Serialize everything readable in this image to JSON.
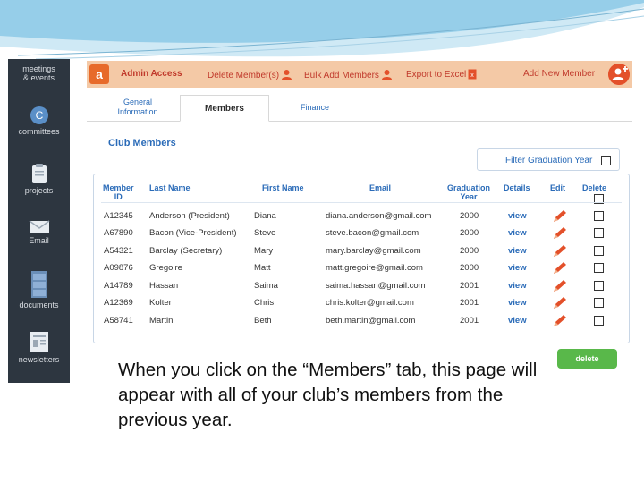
{
  "sidebar": {
    "items": [
      {
        "label": "meetings\n& events",
        "icon": "calendar-icon"
      },
      {
        "label": "committees",
        "icon": "committees-c-icon"
      },
      {
        "label": "projects",
        "icon": "clipboard-icon"
      },
      {
        "label": "Email",
        "icon": "envelope-icon"
      },
      {
        "label": "documents",
        "icon": "file-cabinet-icon"
      },
      {
        "label": "newsletters",
        "icon": "newspaper-icon"
      }
    ]
  },
  "admin_bar": {
    "badge": "a",
    "title": "Admin Access",
    "actions": [
      "Delete Member(s)",
      "Bulk Add Members",
      "Export to Excel",
      "Add New Member"
    ],
    "color": "#e76a2a"
  },
  "tabs": [
    {
      "label": "General\nInformation",
      "active": false
    },
    {
      "label": "Members",
      "active": true
    },
    {
      "label": "Finance",
      "active": false
    }
  ],
  "section_title": "Club Members",
  "filter": {
    "label": "Filter Graduation Year",
    "checked": false
  },
  "table": {
    "headers": {
      "member_id": "Member\nID",
      "last_name": "Last Name",
      "first_name": "First Name",
      "email": "Email",
      "grad_year": "Graduation\nYear",
      "details": "Details",
      "edit": "Edit",
      "delete": "Delete"
    },
    "rows": [
      {
        "id": "A12345",
        "last": "Anderson (President)",
        "first": "Diana",
        "email": "diana.anderson@gmail.com",
        "year": "2000",
        "details": "view"
      },
      {
        "id": "A67890",
        "last": "Bacon (Vice-President)",
        "first": "Steve",
        "email": "steve.bacon@gmail.com",
        "year": "2000",
        "details": "view"
      },
      {
        "id": "A54321",
        "last": "Barclay (Secretary)",
        "first": "Mary",
        "email": "mary.barclay@gmail.com",
        "year": "2000",
        "details": "view"
      },
      {
        "id": "A09876",
        "last": "Gregoire",
        "first": "Matt",
        "email": "matt.gregoire@gmail.com",
        "year": "2000",
        "details": "view"
      },
      {
        "id": "A14789",
        "last": "Hassan",
        "first": "Saima",
        "email": "saima.hassan@gmail.com",
        "year": "2001",
        "details": "view"
      },
      {
        "id": "A12369",
        "last": "Kolter",
        "first": "Chris",
        "email": "chris.kolter@gmail.com",
        "year": "2001",
        "details": "view"
      },
      {
        "id": "A58741",
        "last": "Martin",
        "first": "Beth",
        "email": "beth.martin@gmail.com",
        "year": "2001",
        "details": "view"
      }
    ]
  },
  "delete_button": "delete",
  "caption": "When you click on the “Members” tab, this page will appear with all of your club’s members from the previous year."
}
